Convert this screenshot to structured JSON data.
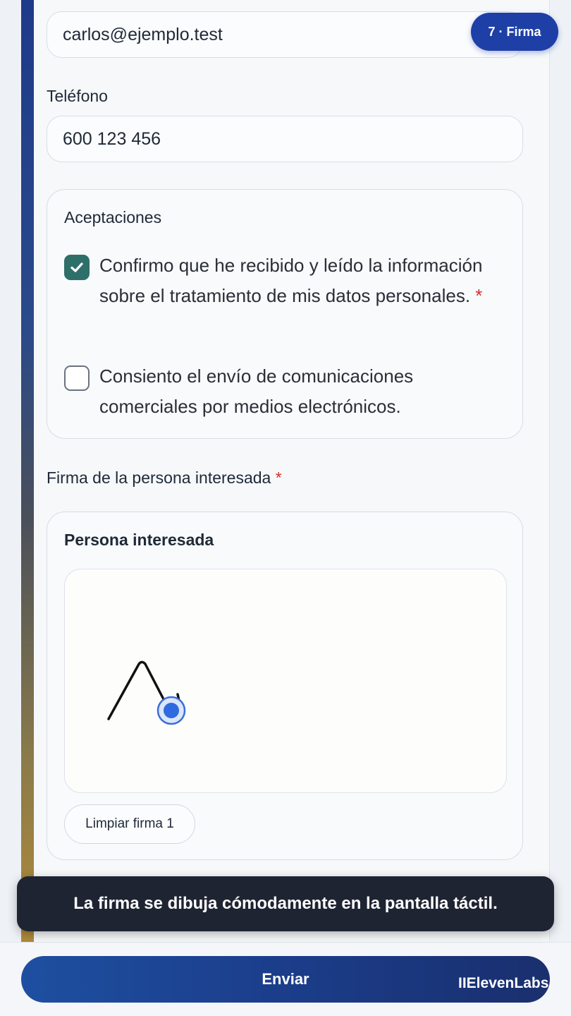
{
  "email": {
    "value": "carlos@ejemplo.test"
  },
  "step_badge": "7 · Firma",
  "phone": {
    "label": "Teléfono",
    "value": "600 123 456"
  },
  "acceptances": {
    "title": "Aceptaciones",
    "items": [
      {
        "text": "Confirmo que he recibido y leído la información sobre el tratamiento de mis datos personales.",
        "required_mark": "*",
        "checked": true
      },
      {
        "text": "Consiento el envío de comunicaciones comerciales por medios electrónicos.",
        "checked": false
      }
    ]
  },
  "signature": {
    "label": "Firma de la persona interesada",
    "required_mark": "*",
    "box_title": "Persona interesada",
    "clear_button": "Limpiar firma 1"
  },
  "toast": "La firma se dibuja cómodamente en la pantalla táctil.",
  "submit_button": "Enviar",
  "watermark": "IIElevenLabs",
  "colors": {
    "accent": "#1e3fa6",
    "checked": "#2f6f6a",
    "required": "#d0312d",
    "toast_bg": "#1f2433"
  }
}
